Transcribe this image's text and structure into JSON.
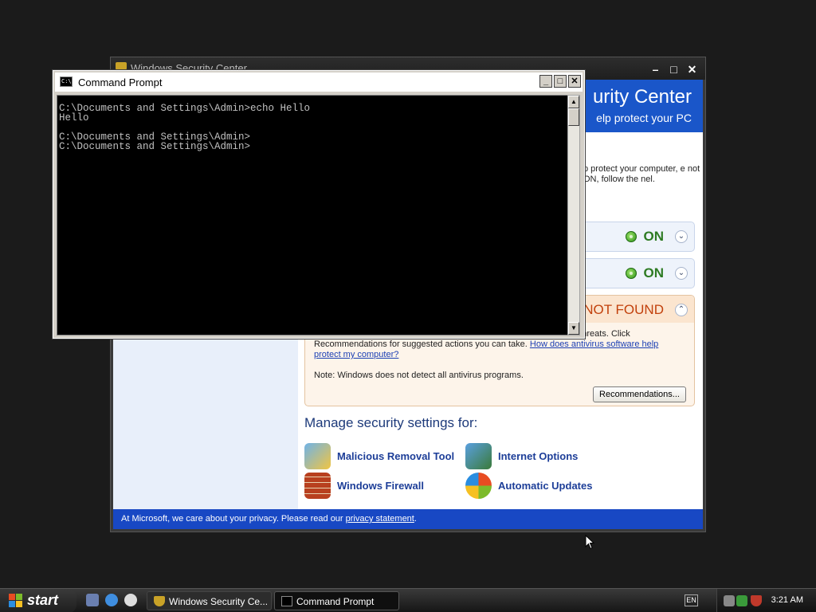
{
  "security_center": {
    "title": "Windows Security Center",
    "header_title": "urity Center",
    "header_subtitle": "elp protect your PC",
    "intro_text": "p protect your computer, e not ON, follow the nel.",
    "firewall_status": "ON",
    "updates_status": "ON",
    "antivirus_status": "NOT FOUND",
    "antivirus_text": "ware helps protect your computer against viruses and other security threats. Click Recommendations for suggested actions you can take.",
    "antivirus_link": "How does antivirus software help protect my computer?",
    "antivirus_note": "Note: Windows does not detect all antivirus programs.",
    "recommendations_button": "Recommendations...",
    "manage_heading": "Manage security settings for:",
    "manage_items": [
      {
        "label": "Malicious Removal Tool",
        "icon": "removal-tool-icon"
      },
      {
        "label": "Internet Options",
        "icon": "internet-options-icon"
      },
      {
        "label": "Windows Firewall",
        "icon": "firewall-icon"
      },
      {
        "label": "Automatic Updates",
        "icon": "updates-icon"
      }
    ],
    "footer_text": "At Microsoft, we care about your privacy.  Please read our",
    "footer_link": "privacy statement",
    "footer_end": "."
  },
  "command_prompt": {
    "title": "Command Prompt",
    "icon_text": "C:\\",
    "lines": [
      "C:\\Documents and Settings\\Admin>echo Hello",
      "Hello",
      "",
      "C:\\Documents and Settings\\Admin>",
      "C:\\Documents and Settings\\Admin>"
    ]
  },
  "taskbar": {
    "start_label": "start",
    "tasks": [
      {
        "label": "Windows Security Ce..."
      },
      {
        "label": "Command Prompt"
      }
    ],
    "language": "EN",
    "clock": "3:21 AM"
  },
  "colors": {
    "accent_blue": "#1a56c9",
    "status_green": "#2e7b23",
    "status_orange": "#c2410c"
  }
}
